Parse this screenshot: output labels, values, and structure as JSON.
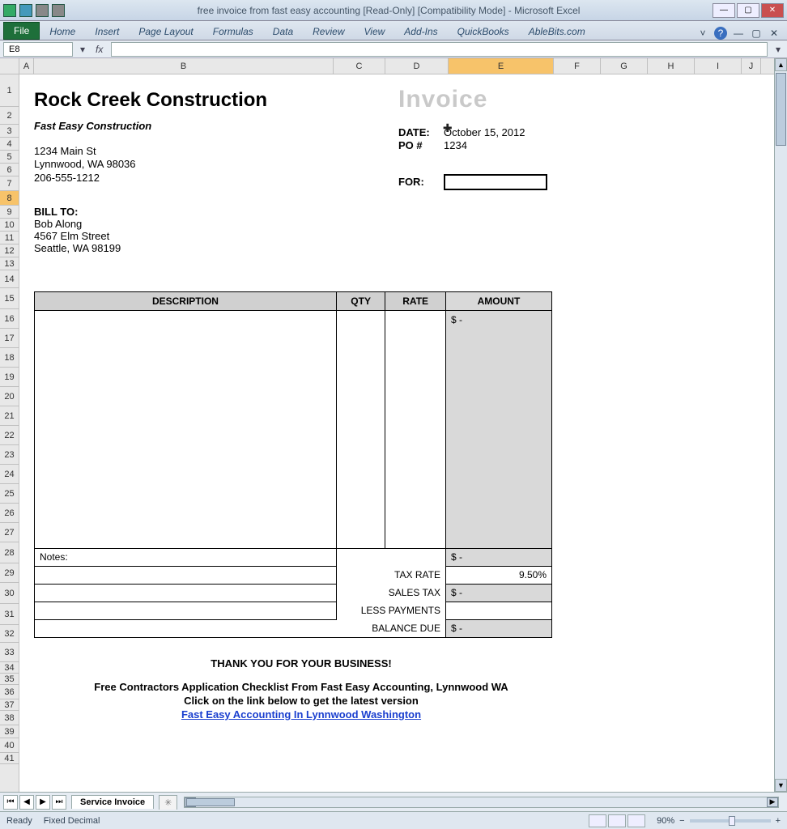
{
  "window": {
    "title": "free invoice from fast easy accounting  [Read-Only]  [Compatibility Mode] - Microsoft Excel"
  },
  "ribbon": {
    "file": "File",
    "tabs": [
      "Home",
      "Insert",
      "Page Layout",
      "Formulas",
      "Data",
      "Review",
      "View",
      "Add-Ins",
      "QuickBooks",
      "AbleBits.com"
    ]
  },
  "namebox": "E8",
  "fx": "fx",
  "columns": [
    "A",
    "B",
    "C",
    "D",
    "E",
    "F",
    "G",
    "H",
    "I",
    "J"
  ],
  "rows": [
    "1",
    "2",
    "3",
    "4",
    "5",
    "6",
    "7",
    "8",
    "9",
    "10",
    "11",
    "12",
    "13",
    "14",
    "15",
    "16",
    "17",
    "18",
    "19",
    "20",
    "21",
    "22",
    "23",
    "24",
    "25",
    "26",
    "27",
    "28",
    "29",
    "30",
    "31",
    "32",
    "33",
    "34",
    "35",
    "36",
    "37",
    "38",
    "39",
    "40",
    "41"
  ],
  "selected_col": "E",
  "selected_row": "8",
  "invoice": {
    "company": "Rock Creek Construction",
    "title": "Invoice",
    "subhead": "Fast Easy Construction",
    "from": {
      "street": "1234 Main St",
      "citystate": "Lynnwood, WA 98036",
      "phone": "206-555-1212"
    },
    "meta": {
      "date_label": "DATE:",
      "date": "October 15, 2012",
      "po_label": "PO #",
      "po": "1234",
      "for_label": "FOR:"
    },
    "billto": {
      "label": "BILL TO:",
      "name": "Bob Along",
      "street": "4567 Elm Street",
      "citystate": "Seattle, WA 98199"
    },
    "table": {
      "headers": {
        "desc": "DESCRIPTION",
        "qty": "QTY",
        "rate": "RATE",
        "amount": "AMOUNT"
      },
      "first_amount": "$                     -",
      "notes_label": "Notes:",
      "subtotal_amount": "$                     -",
      "tax_rate_label": "TAX RATE",
      "tax_rate": "9.50%",
      "sales_tax_label": "SALES TAX",
      "sales_tax": "$                     -",
      "less_label": "LESS PAYMENTS",
      "balance_label": "BALANCE DUE",
      "balance": "$                     -"
    },
    "footer": {
      "thanks": "THANK YOU FOR YOUR BUSINESS!",
      "promo": "Free Contractors Application Checklist From Fast Easy Accounting, Lynnwood WA",
      "sub": "Click on the link below to get the latest version",
      "link": "Fast Easy Accounting In Lynnwood Washington"
    }
  },
  "sheet_tab": "Service Invoice",
  "status": {
    "ready": "Ready",
    "fixed": "Fixed Decimal",
    "zoom": "90%"
  }
}
